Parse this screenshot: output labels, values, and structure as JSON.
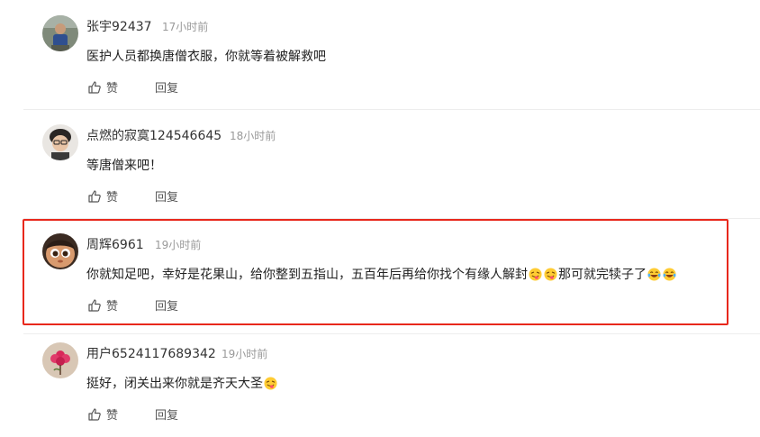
{
  "comments": [
    {
      "username": "张宇92437",
      "time": "17小时前",
      "text": "医护人员都换唐僧衣服，你就等着被解救吧",
      "like_label": "赞",
      "reply_label": "回复",
      "avatar": "photo-person-outdoors"
    },
    {
      "username": "点燃的寂寞124546645",
      "time": "18小时前",
      "text": "等唐僧来吧！",
      "like_label": "赞",
      "reply_label": "回复",
      "avatar": "photo-person-glasses"
    },
    {
      "username": "周辉6961",
      "time": "19小时前",
      "text_part1": "你就知足吧，幸好是花果山，给你整到五指山，五百年后再给你找个有缘人解封",
      "emoji_a": "tongue-face-emoji",
      "text_part2": "那可就完犊子了",
      "emoji_b": "laughing-tears-emoji",
      "like_label": "赞",
      "reply_label": "回复",
      "avatar": "cartoon-boy"
    },
    {
      "username": "用户6524117689342",
      "time": "19小时前",
      "text": "挺好，闭关出来你就是齐天大圣",
      "emoji": "tongue-face-emoji",
      "like_label": "赞",
      "reply_label": "回复",
      "avatar": "red-flower-drawing"
    }
  ],
  "colors": {
    "highlight_border": "#e8281c",
    "username": "#333333",
    "timestamp": "#999999",
    "body_text": "#222222",
    "action_text": "#555555"
  }
}
